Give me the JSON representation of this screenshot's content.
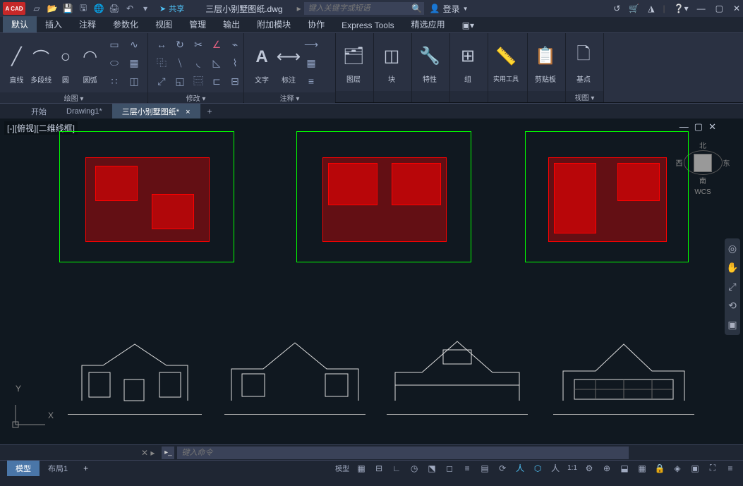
{
  "app": {
    "logo": "A CAD",
    "filename": "三层小别墅图纸.dwg"
  },
  "share": {
    "label": "共享"
  },
  "search": {
    "placeholder": "键入关键字或短语"
  },
  "login": {
    "label": "登录"
  },
  "ribbon_tabs": [
    "默认",
    "插入",
    "注释",
    "参数化",
    "视图",
    "管理",
    "输出",
    "附加模块",
    "协作",
    "Express Tools",
    "精选应用"
  ],
  "ribbon_active": 0,
  "panels": {
    "draw": {
      "label": "绘图 ▾",
      "line": "直线",
      "polyline": "多段线",
      "circle": "圆",
      "arc": "圆弧"
    },
    "modify": {
      "label": "修改 ▾"
    },
    "annotate": {
      "label": "注释 ▾",
      "text": "文字",
      "dim": "标注"
    },
    "layer": {
      "label": "图层"
    },
    "block": {
      "label": "块"
    },
    "properties": {
      "label": "特性"
    },
    "group": {
      "label": "组"
    },
    "tools": {
      "label": "实用工具"
    },
    "clipboard": {
      "label": "剪贴板"
    },
    "base": {
      "label": "基点"
    },
    "view": {
      "label": "视图 ▾"
    }
  },
  "doc_tabs": {
    "start": "开始",
    "d1": "Drawing1*",
    "active": "三层小别墅图纸*"
  },
  "viewport": {
    "label": "[-][俯视][二维线框]",
    "wcs": "WCS",
    "north": "北",
    "south": "南",
    "east": "东",
    "west": "西"
  },
  "ucs": {
    "y": "Y",
    "x": "X"
  },
  "command": {
    "placeholder": "键入命令"
  },
  "layout_tabs": {
    "model": "模型",
    "layout1": "布局1"
  },
  "status": {
    "model": "模型",
    "scale": "1:1"
  }
}
